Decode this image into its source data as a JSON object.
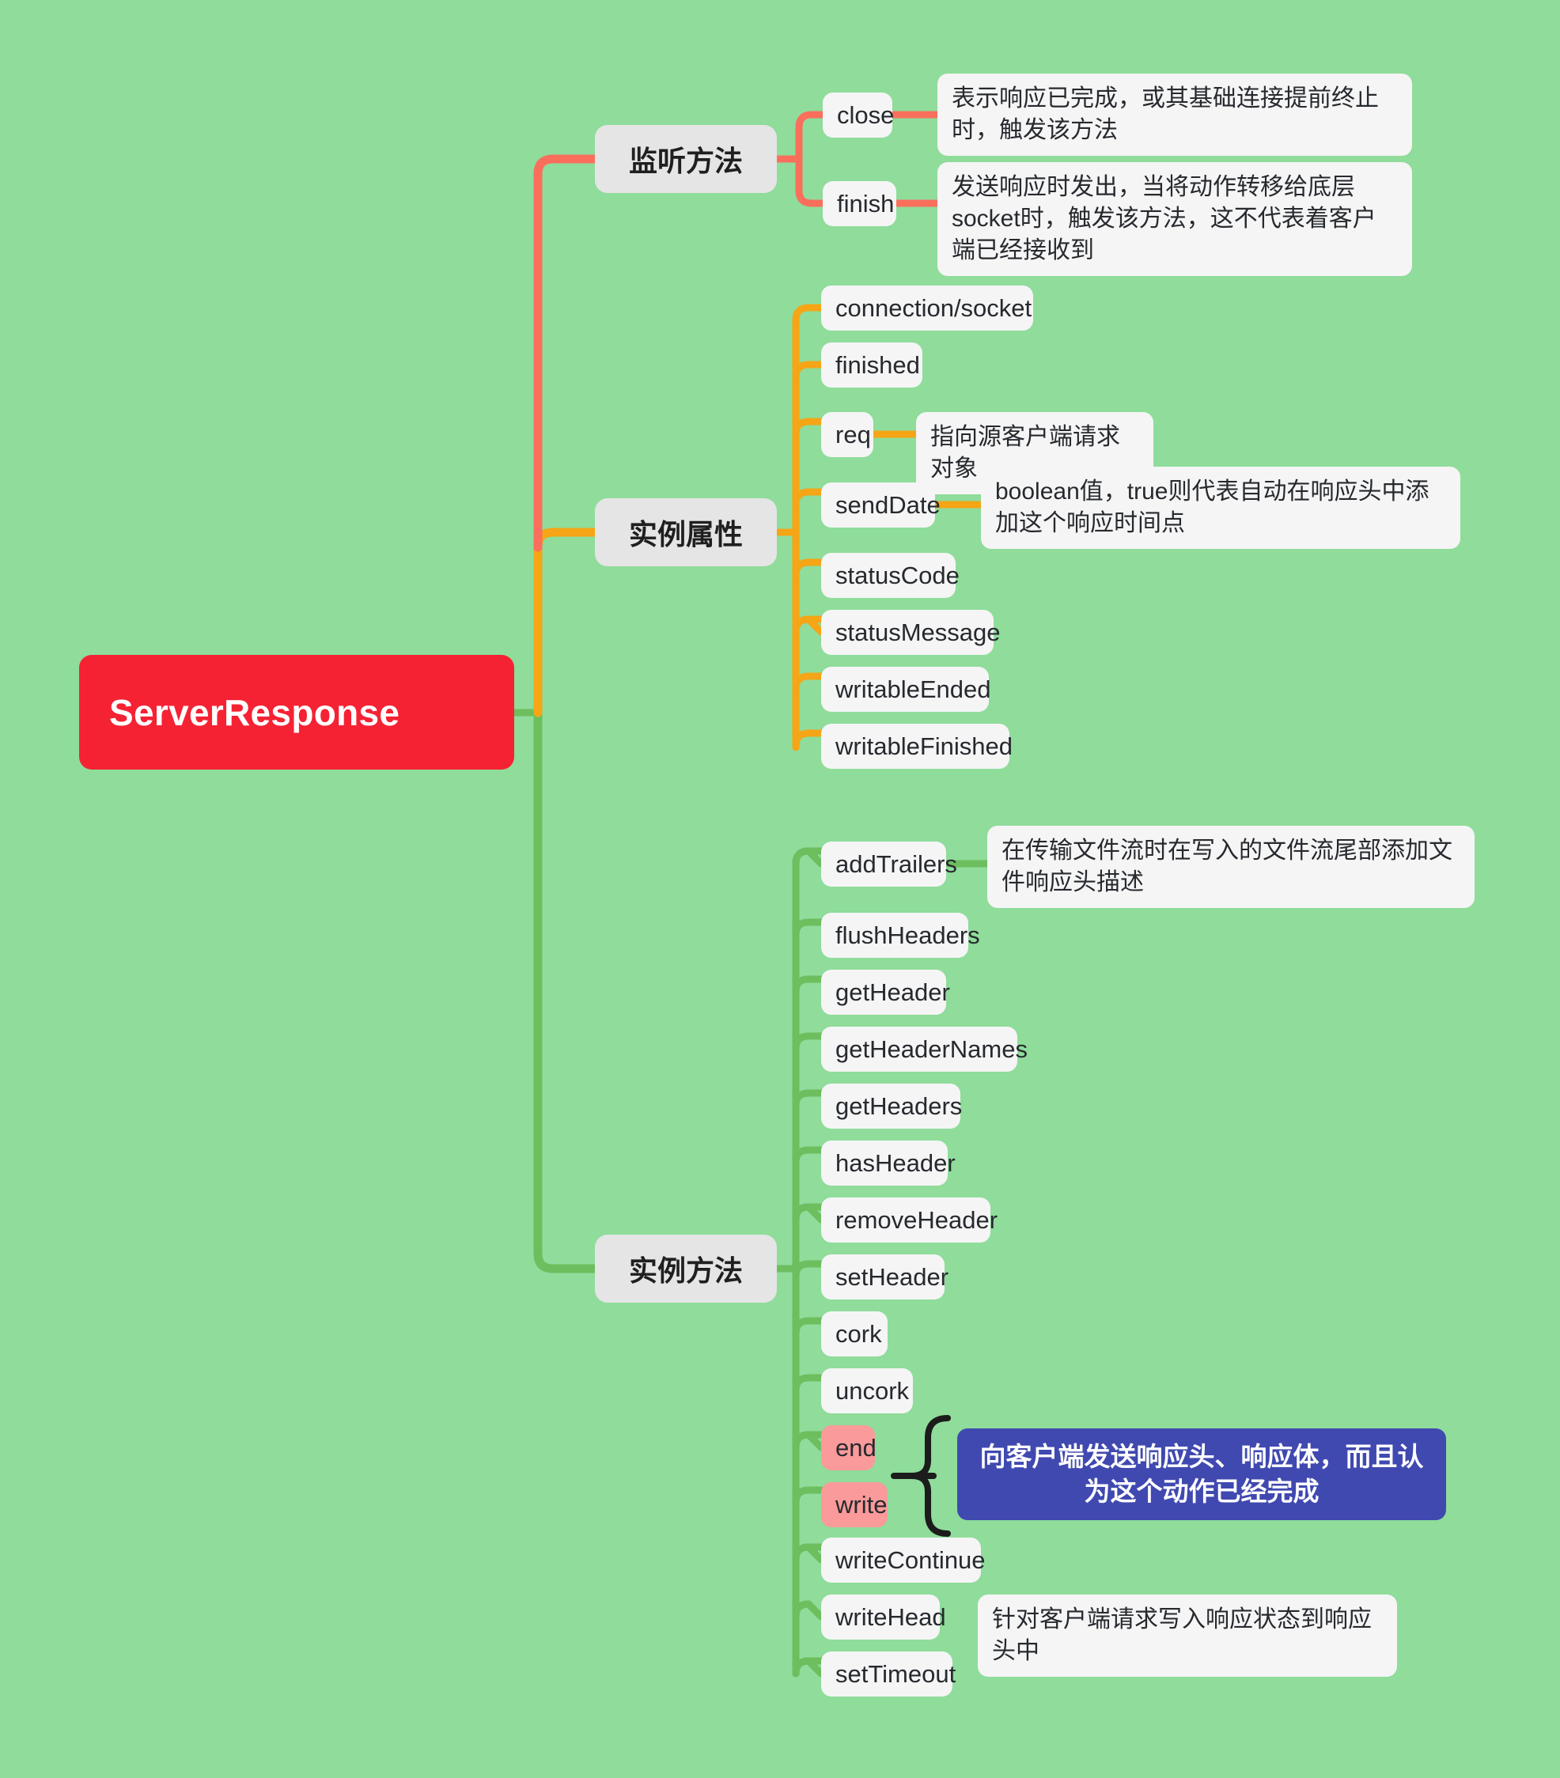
{
  "diagram": {
    "type": "mindmap",
    "background_color": "#8FDC9B",
    "root": {
      "label": "ServerResponse",
      "color": "#F52233",
      "text_color": "#FFFFFF"
    },
    "branches": [
      {
        "id": "listen-methods",
        "label": "监听方法",
        "connector_color": "#FA6F5C",
        "children": [
          {
            "label": "close",
            "note": "表示响应已完成，或其基础连接提前终止时，触发该方法"
          },
          {
            "label": "finish",
            "note": "发送响应时发出，当将动作转移给底层socket时，触发该方法，这不代表着客户端已经接收到"
          }
        ]
      },
      {
        "id": "instance-properties",
        "label": "实例属性",
        "connector_color": "#F5A515",
        "children": [
          {
            "label": "connection/socket",
            "note": ""
          },
          {
            "label": "finished",
            "note": ""
          },
          {
            "label": "req",
            "note": "指向源客户端请求对象"
          },
          {
            "label": "sendDate",
            "note": "boolean值，true则代表自动在响应头中添加这个响应时间点"
          },
          {
            "label": "statusCode",
            "note": ""
          },
          {
            "label": "statusMessage",
            "note": ""
          },
          {
            "label": "writableEnded",
            "note": ""
          },
          {
            "label": "writableFinished",
            "note": ""
          }
        ]
      },
      {
        "id": "instance-methods",
        "label": "实例方法",
        "connector_color": "#6DBE5E",
        "children": [
          {
            "label": "addTrailers",
            "note": "在传输文件流时在写入的文件流尾部添加文件响应头描述"
          },
          {
            "label": "flushHeaders",
            "note": ""
          },
          {
            "label": "getHeader",
            "note": ""
          },
          {
            "label": "getHeaderNames",
            "note": ""
          },
          {
            "label": "getHeaders",
            "note": ""
          },
          {
            "label": "hasHeader",
            "note": ""
          },
          {
            "label": "removeHeader",
            "note": ""
          },
          {
            "label": "setHeader",
            "note": ""
          },
          {
            "label": "cork",
            "note": ""
          },
          {
            "label": "uncork",
            "note": ""
          },
          {
            "label": "end",
            "note": "",
            "highlight": "#FA9A9A"
          },
          {
            "label": "write",
            "note": "",
            "highlight": "#FA9A9A"
          },
          {
            "label": "writeContinue",
            "note": ""
          },
          {
            "label": "writeHead",
            "note": "针对客户端请求写入响应状态到响应头中"
          },
          {
            "label": "setTimeout",
            "note": ""
          }
        ],
        "grouped_callout": {
          "members": [
            "end",
            "write"
          ],
          "text": "向客户端发送响应头、响应体，而且认为这个动作已经完成",
          "color": "#4049B0",
          "text_color": "#FFFFFF"
        }
      }
    ]
  }
}
